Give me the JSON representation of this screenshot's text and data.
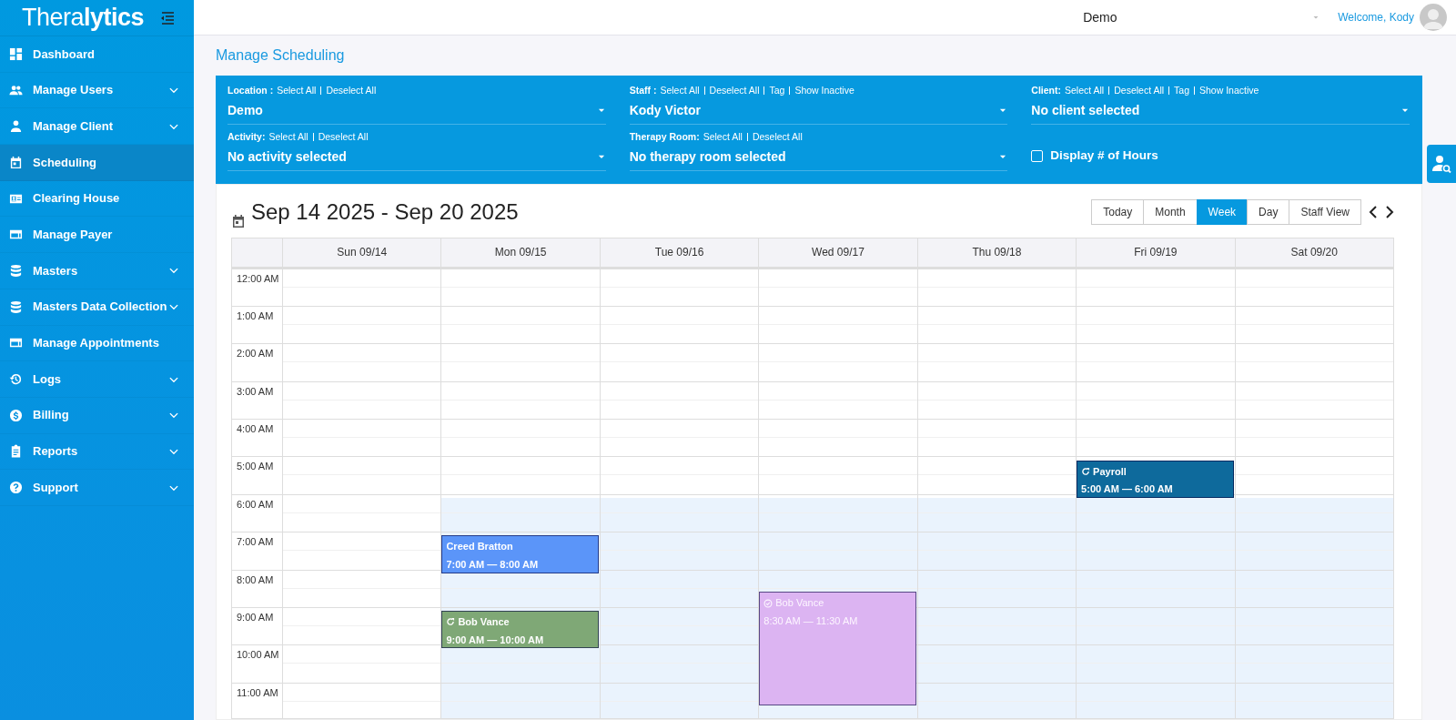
{
  "sidebar": {
    "logo": {
      "prefix": "Thera",
      "suffix": "lytics"
    },
    "items": [
      {
        "label": "Dashboard",
        "expandable": false,
        "selected": false
      },
      {
        "label": "Manage Users",
        "expandable": true,
        "selected": false
      },
      {
        "label": "Manage Client",
        "expandable": true,
        "selected": false
      },
      {
        "label": "Scheduling",
        "expandable": false,
        "selected": true
      },
      {
        "label": "Clearing House",
        "expandable": false,
        "selected": false
      },
      {
        "label": "Manage Payer",
        "expandable": false,
        "selected": false
      },
      {
        "label": "Masters",
        "expandable": true,
        "selected": false
      },
      {
        "label": "Masters Data Collection",
        "expandable": true,
        "selected": false
      },
      {
        "label": "Manage Appointments",
        "expandable": false,
        "selected": false
      },
      {
        "label": "Logs",
        "expandable": true,
        "selected": false
      },
      {
        "label": "Billing",
        "expandable": true,
        "selected": false
      },
      {
        "label": "Reports",
        "expandable": true,
        "selected": false
      },
      {
        "label": "Support",
        "expandable": true,
        "selected": false
      }
    ]
  },
  "header": {
    "location": "Demo",
    "welcome": "Welcome, Kody"
  },
  "page_title": "Manage Scheduling",
  "filters": [
    {
      "label": "Location :",
      "links": [
        "Select All",
        "Deselect All"
      ],
      "value": "Demo"
    },
    {
      "label": "Staff :",
      "links": [
        "Select All",
        "Deselect All",
        "Tag",
        "Show Inactive"
      ],
      "value": "Kody Victor"
    },
    {
      "label": "Client:",
      "links": [
        "Select All",
        "Deselect All",
        "Tag",
        "Show Inactive"
      ],
      "value": "No client selected"
    },
    {
      "label": "Activity:",
      "links": [
        "Select All",
        "Deselect All"
      ],
      "value": "No activity selected"
    },
    {
      "label": "Therapy Room:",
      "links": [
        "Select All",
        "Deselect All"
      ],
      "value": "No therapy room selected"
    }
  ],
  "display_hours": {
    "label": "Display # of Hours",
    "checked": false
  },
  "calendar": {
    "range": "Sep 14 2025 - Sep 20 2025",
    "views": [
      {
        "label": "Today",
        "selected": false
      },
      {
        "label": "Month",
        "selected": false
      },
      {
        "label": "Week",
        "selected": true
      },
      {
        "label": "Day",
        "selected": false
      },
      {
        "label": "Staff View",
        "selected": false
      }
    ],
    "hours": [
      {
        "label": "12:00 AM"
      },
      {
        "label": "1:00 AM"
      },
      {
        "label": "2:00 AM"
      },
      {
        "label": "3:00 AM"
      },
      {
        "label": "4:00 AM"
      },
      {
        "label": "5:00 AM"
      },
      {
        "label": "6:00 AM"
      },
      {
        "label": "7:00 AM"
      },
      {
        "label": "8:00 AM"
      },
      {
        "label": "9:00 AM"
      },
      {
        "label": "10:00 AM"
      },
      {
        "label": "11:00 AM"
      }
    ],
    "days": [
      {
        "label": "Sun 09/14",
        "open": false
      },
      {
        "label": "Mon 09/15",
        "open": true,
        "events": [
          {
            "kind": "plain",
            "title": "Creed Bratton",
            "time": "7:00 AM — 8:00 AM",
            "color": "#5b95f9"
          },
          {
            "kind": "recurring",
            "title": "Bob Vance",
            "time": "9:00 AM — 10:00 AM",
            "color": "#7fa876"
          }
        ]
      },
      {
        "label": "Tue 09/16",
        "open": true
      },
      {
        "label": "Wed 09/17",
        "open": true,
        "events": [
          {
            "kind": "done",
            "title": "Bob Vance",
            "time": "8:30 AM — 11:30 AM",
            "color": "#dcb4f2"
          }
        ]
      },
      {
        "label": "Thu 09/18",
        "open": true
      },
      {
        "label": "Fri 09/19",
        "open": true,
        "events": [
          {
            "kind": "recurring",
            "title": "Payroll",
            "time": "5:00 AM — 6:00 AM",
            "color": "#0e6a9c"
          }
        ]
      },
      {
        "label": "Sat 09/20",
        "open": true
      }
    ]
  }
}
